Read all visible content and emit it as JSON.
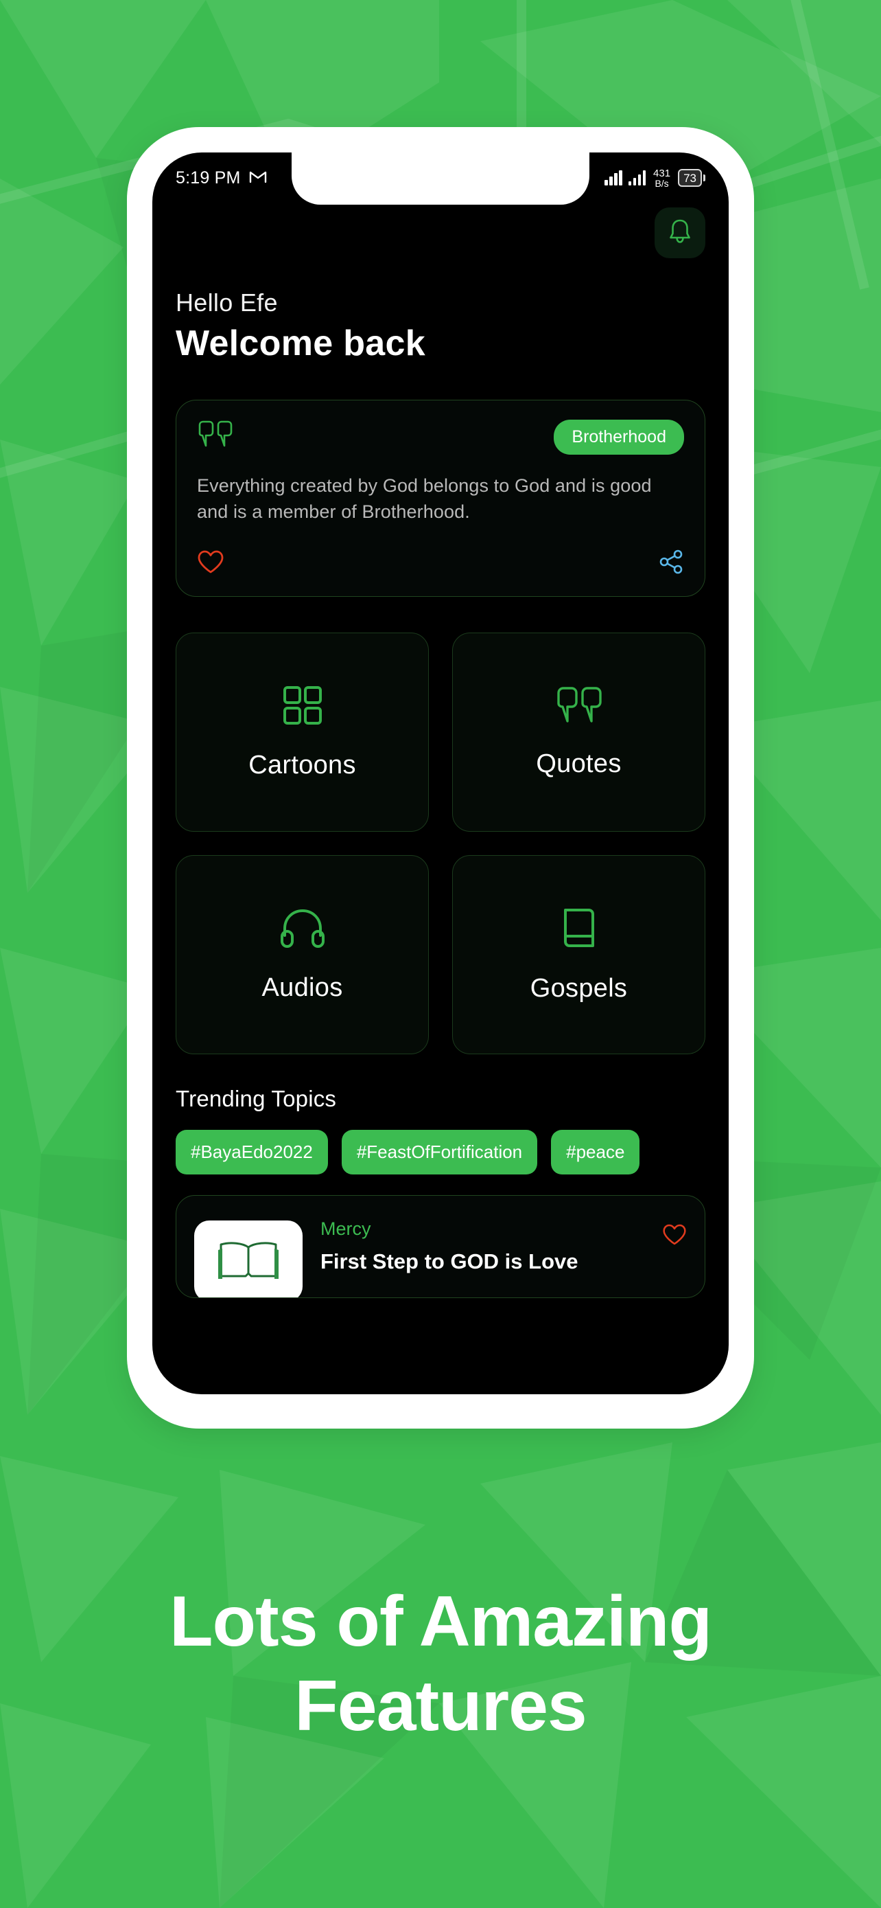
{
  "statusbar": {
    "time": "5:19 PM",
    "gmail_icon": "gmail-icon",
    "net_speed_value": "431",
    "net_speed_unit": "B/s",
    "battery_level": "73"
  },
  "header": {
    "bell_icon": "bell-icon",
    "greeting": "Hello Efe",
    "title": "Welcome back"
  },
  "quote_card": {
    "quote_icon": "quote-marks-icon",
    "badge": "Brotherhood",
    "text": "Everything created by God belongs to God and is good and is a member of Brotherhood.",
    "like_icon": "heart-icon",
    "share_icon": "share-icon"
  },
  "features": {
    "tiles": [
      {
        "label": "Cartoons",
        "icon": "grid-squares-icon"
      },
      {
        "label": "Quotes",
        "icon": "quote-marks-icon"
      },
      {
        "label": "Audios",
        "icon": "headphones-icon"
      },
      {
        "label": "Gospels",
        "icon": "book-icon"
      }
    ]
  },
  "trending": {
    "title": "Trending Topics",
    "tags": [
      "#BayaEdo2022",
      "#FeastOfFortification",
      "#peace"
    ]
  },
  "list_item": {
    "thumbnail_icon": "open-book-icon",
    "category": "Mercy",
    "title": "First Step to GOD is Love",
    "like_icon": "heart-icon"
  },
  "promo": {
    "headline": "Lots of Amazing Features"
  },
  "colors": {
    "brand_green": "#3CBC51",
    "background_green": "#3CBC51",
    "screen_black": "#000000",
    "accent_icon_green": "#35B24A",
    "heart_red": "#E23B1E",
    "share_blue": "#5AB7E8",
    "frame_white": "#FFFFFF"
  }
}
